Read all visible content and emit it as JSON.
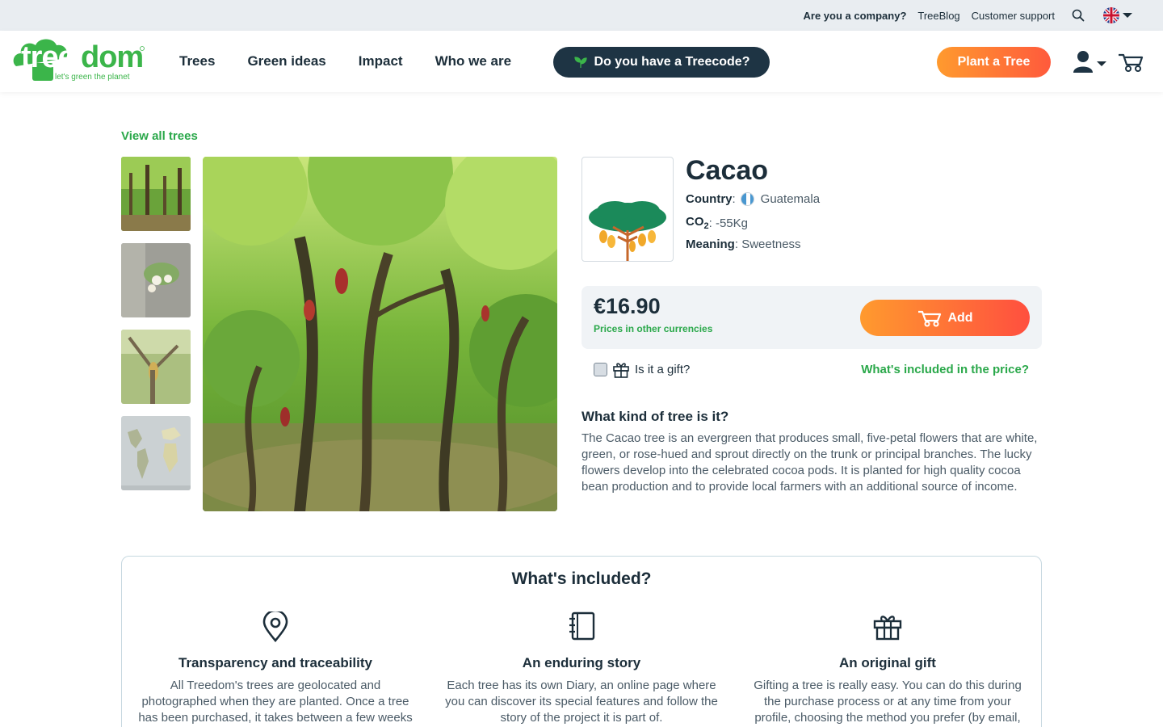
{
  "topbar": {
    "company": "Are you a company?",
    "blog": "TreeBlog",
    "support": "Customer support"
  },
  "brand": {
    "name": "treedom",
    "tagline": "let's green the planet",
    "green": "#3bb54a",
    "dark": "#1e3444",
    "orange": "#ff9a2e"
  },
  "nav": {
    "items": [
      "Trees",
      "Green ideas",
      "Impact",
      "Who we are"
    ],
    "treecode": "Do you have a Treecode?",
    "plant": "Plant a Tree"
  },
  "breadcrumb": {
    "view_all": "View all trees"
  },
  "product": {
    "title": "Cacao",
    "country_label": "Country",
    "country": "Guatemala",
    "co2_label": "CO",
    "co2_sub": "2",
    "co2_value": "-55Kg",
    "meaning_label": "Meaning",
    "meaning": "Sweetness",
    "price": "€16.90",
    "other_currencies": "Prices in other currencies",
    "add": "Add",
    "gift": "Is it a gift?",
    "whats_included_link": "What's included in the price?",
    "kind_title": "What kind of tree is it?",
    "kind_text": "The Cacao tree is an evergreen that produces small, five-petal flowers that are white, green, or rose-hued and sprout directly on the trunk or principal branches. The lucky flowers develop into the celebrated cocoa pods. It is planted for high quality cocoa bean production and to provide local farmers with an additional source of income."
  },
  "included": {
    "title": "What's included?",
    "features": [
      {
        "icon": "location-pin-icon",
        "title": "Transparency and traceability",
        "text": "All Treedom's trees are geolocated and photographed when they are planted. Once a tree has been purchased, it takes between a few weeks"
      },
      {
        "icon": "notebook-icon",
        "title": "An enduring story",
        "text": "Each tree has its own Diary, an online page where you can discover its special features and follow the story of the project it is part of."
      },
      {
        "icon": "gift-icon",
        "title": "An original gift",
        "text": "Gifting a tree is really easy. You can do this during the purchase process or at any time from your profile, choosing the method you prefer (by email,"
      }
    ]
  }
}
